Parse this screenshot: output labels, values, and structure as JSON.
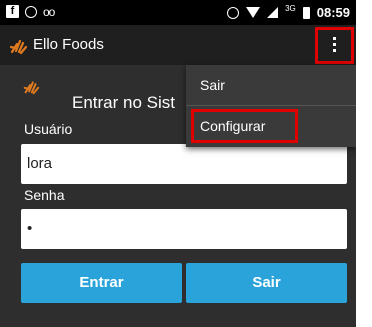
{
  "status_bar": {
    "left_icons": [
      "facebook-icon",
      "whatsapp-icon",
      "voicemail-icon"
    ],
    "right_icons": [
      "alarm-icon",
      "wifi-icon",
      "signal-icon",
      "battery-icon"
    ],
    "network_label": "3G",
    "time": "08:59"
  },
  "action_bar": {
    "title": "Ello Foods",
    "logo_icon": "hand-logo-icon",
    "overflow_icon": "more-vert-icon"
  },
  "form": {
    "title": "Entrar no Sist",
    "username_label": "Usuário",
    "username_value": "lora",
    "password_label": "Senha",
    "password_value": "•",
    "login_button": "Entrar",
    "exit_button": "Sair"
  },
  "popup_menu": {
    "items": [
      {
        "label": "Sair"
      },
      {
        "label": "Configurar"
      }
    ]
  },
  "colors": {
    "accent": "#29a3d9",
    "highlight": "#e00000",
    "background": "#2e2e2e",
    "action_bar": "#1f1f1f",
    "logo": "#e07a1f"
  }
}
